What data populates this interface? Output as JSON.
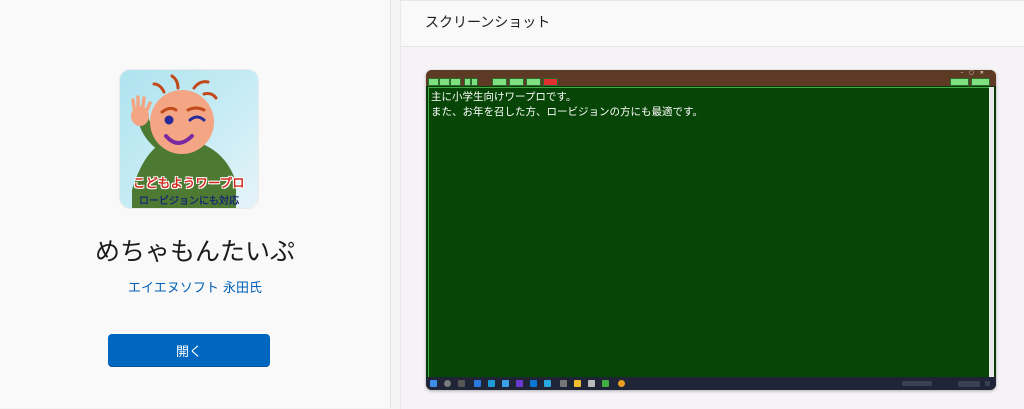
{
  "app": {
    "icon_title": "こどもようワープロ",
    "icon_subtitle": "ロービジョンにも対応",
    "name": "めちゃもんたいぷ",
    "publisher": "エイエヌソフト 永田氏",
    "open_label": "開く"
  },
  "screenshots": {
    "section_title": "スクリーンショット",
    "document_lines": [
      "主に小学生向けワープロです。",
      "また、お年を召した方、ロービジョンの方にも最適です。"
    ]
  },
  "colors": {
    "accent": "#0067c0",
    "publisher_link": "#005fb8",
    "editor_bg": "#064506",
    "editor_border": "#3fb03f",
    "window_chrome": "#5c3a24",
    "icon_title": "#d2281d"
  }
}
